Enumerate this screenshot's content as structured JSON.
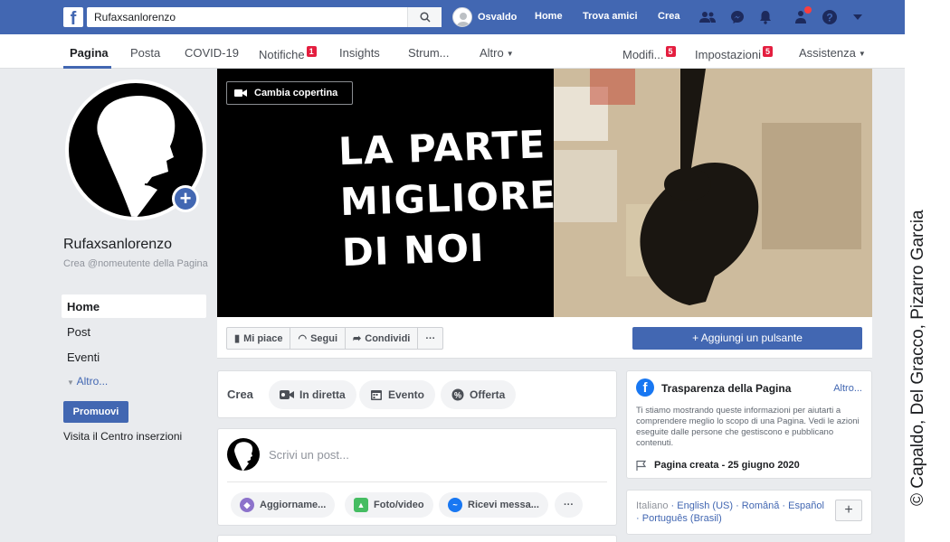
{
  "topbar": {
    "search_value": "Rufaxsanlorenzo",
    "user_name": "Osvaldo",
    "links": [
      "Home",
      "Trova amici",
      "Crea"
    ]
  },
  "subnav": {
    "tabs": [
      {
        "label": "Pagina"
      },
      {
        "label": "Posta"
      },
      {
        "label": "COVID-19"
      },
      {
        "label": "Notifiche",
        "badge": "1"
      },
      {
        "label": "Insights"
      },
      {
        "label": "Strum..."
      },
      {
        "label": "Altro"
      }
    ],
    "right": [
      {
        "label": "Modifi...",
        "badge": "5"
      },
      {
        "label": "Impostazioni",
        "badge": "5"
      },
      {
        "label": "Assistenza"
      }
    ]
  },
  "page": {
    "name": "Rufaxsanlorenzo",
    "username_hint": "Crea @nomeutente della Pagina",
    "nav": [
      "Home",
      "Post",
      "Eventi"
    ],
    "altro": "Altro...",
    "promuovi": "Promuovi",
    "visita": "Visita il Centro inserzioni"
  },
  "cover": {
    "button": "Cambia copertina",
    "line1": "LA PARTE",
    "line2": "MIGLIORE",
    "line3": "DI NOI"
  },
  "actions": {
    "like": "Mi piace",
    "follow": "Segui",
    "share": "Condividi",
    "more": "···",
    "add_button": "+ Aggiungi un pulsante"
  },
  "crea": {
    "label": "Crea",
    "live": "In diretta",
    "event": "Evento",
    "offer": "Offerta"
  },
  "composer": {
    "placeholder": "Scrivi un post...",
    "options": [
      "Aggiorname...",
      "Foto/video",
      "Ricevi messa...",
      "···"
    ]
  },
  "transparency": {
    "title": "Trasparenza della Pagina",
    "more": "Altro...",
    "body": "Ti stiamo mostrando queste informazioni per aiutarti a comprendere meglio lo scopo di una Pagina. Vedi le azioni eseguite dalle persone che gestiscono e pubblicano contenuti.",
    "created": "Pagina creata - 25 giugno 2020"
  },
  "languages": {
    "current": "Italiano",
    "others": [
      "English (US)",
      "Română",
      "Español",
      "Português (Brasil)"
    ],
    "add": "+"
  },
  "credit": "© Capaldo, Del Gracco, Pizarro Garcia",
  "colors": {
    "brand": "#4267b2",
    "badge": "#e41e3f"
  }
}
